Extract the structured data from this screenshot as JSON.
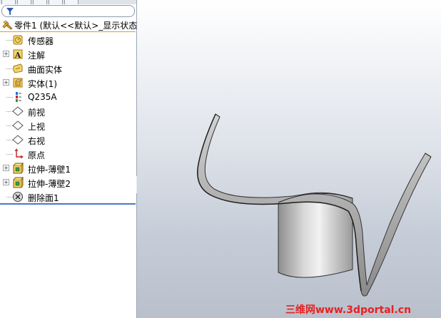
{
  "root": {
    "label": "零件1  (默认<<默认>_显示状态"
  },
  "tree_items": [
    {
      "label": "传感器",
      "icon": "sensor-icon",
      "expandable": false
    },
    {
      "label": "注解",
      "icon": "annotation-icon",
      "expandable": true
    },
    {
      "label": "曲面实体",
      "icon": "surface-bodies-icon",
      "expandable": false
    },
    {
      "label": "实体(1)",
      "icon": "solid-bodies-icon",
      "expandable": true
    },
    {
      "label": "Q235A",
      "icon": "material-icon",
      "expandable": false
    },
    {
      "label": "前视",
      "icon": "plane-icon",
      "expandable": false
    },
    {
      "label": "上视",
      "icon": "plane-icon",
      "expandable": false
    },
    {
      "label": "右视",
      "icon": "plane-icon",
      "expandable": false
    },
    {
      "label": "原点",
      "icon": "origin-icon",
      "expandable": false
    },
    {
      "label": "拉伸-薄壁1",
      "icon": "extrude-thin-icon",
      "expandable": true
    },
    {
      "label": "拉伸-薄壁2",
      "icon": "extrude-thin-icon",
      "expandable": true
    },
    {
      "label": "删除面1",
      "icon": "delete-face-icon",
      "expandable": false
    }
  ],
  "watermark": "三维网www.3dportal.cn",
  "colors": {
    "accent": "#4a78c8",
    "feature_highlight": "#e0a020",
    "watermark": "#e82020"
  }
}
